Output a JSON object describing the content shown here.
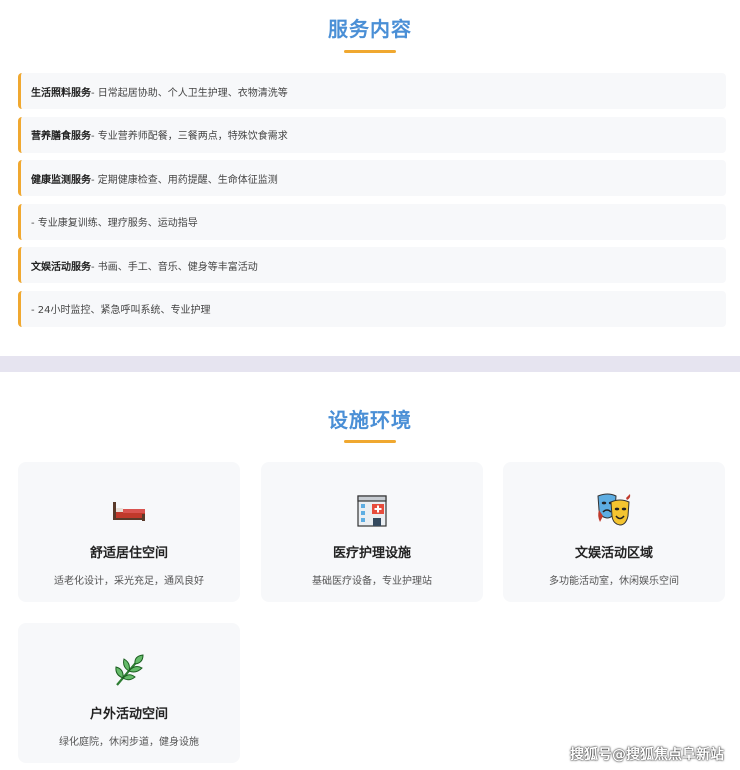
{
  "services": {
    "title": "服务内容",
    "items": [
      {
        "name": "生活照料服务",
        "desc": " - 日常起居协助、个人卫生护理、衣物清洗等"
      },
      {
        "name": "营养膳食服务",
        "desc": " - 专业营养师配餐，三餐两点，特殊饮食需求"
      },
      {
        "name": "健康监测服务",
        "desc": " - 定期健康检查、用药提醒、生命体征监测"
      },
      {
        "name": "",
        "desc": " - 专业康复训练、理疗服务、运动指导"
      },
      {
        "name": "文娱活动服务",
        "desc": " - 书画、手工、音乐、健身等丰富活动"
      },
      {
        "name": "",
        "desc": " - 24小时监控、紧急呼叫系统、专业护理"
      }
    ]
  },
  "facilities": {
    "title": "设施环境",
    "cards": [
      {
        "icon": "bed-icon",
        "title": "舒适居住空间",
        "desc": "适老化设计，采光充足，通风良好"
      },
      {
        "icon": "hospital-icon",
        "title": "医疗护理设施",
        "desc": "基础医疗设备，专业护理站"
      },
      {
        "icon": "theater-masks-icon",
        "title": "文娱活动区域",
        "desc": "多功能活动室，休闲娱乐空间"
      },
      {
        "icon": "herb-icon",
        "title": "户外活动空间",
        "desc": "绿化庭院，休闲步道，健身设施"
      }
    ]
  },
  "colors": {
    "title_blue": "#4a8fd6",
    "accent_orange": "#f0a830",
    "card_bg": "#f7f8fa",
    "divider": "#e6e4f0"
  },
  "watermark": "搜狐号@搜狐焦点阜新站"
}
